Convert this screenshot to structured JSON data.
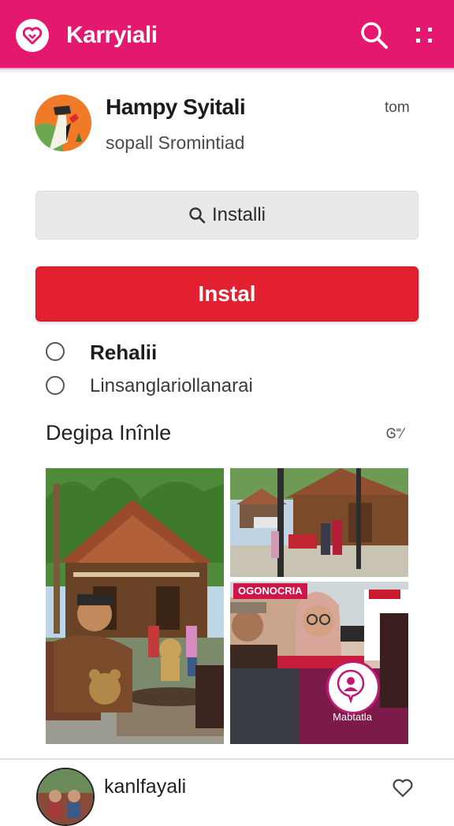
{
  "app": {
    "title": "Karryiali",
    "brand_color": "#e5186f",
    "accent_red": "#e3202f"
  },
  "header": {
    "search_icon": "search-icon",
    "menu_icon": "dots-grid-icon"
  },
  "profile": {
    "name": "Hampy Syitali",
    "subtitle": "sopall Sromintiad",
    "time": "tom"
  },
  "actions": {
    "secondary_label": "Installi",
    "primary_label": "Instal"
  },
  "options": [
    {
      "label": "Rehalii",
      "selected": false
    },
    {
      "label": "Linsanglariollanarai",
      "selected": false
    }
  ],
  "section": {
    "title": "Degipa Inînle",
    "more": "Ꮆ⁼⁄"
  },
  "gallery": {
    "tag_text": "OGONOCRIA",
    "fab_label": "Mabtatla"
  },
  "feed": {
    "name": "kanlfayali"
  }
}
